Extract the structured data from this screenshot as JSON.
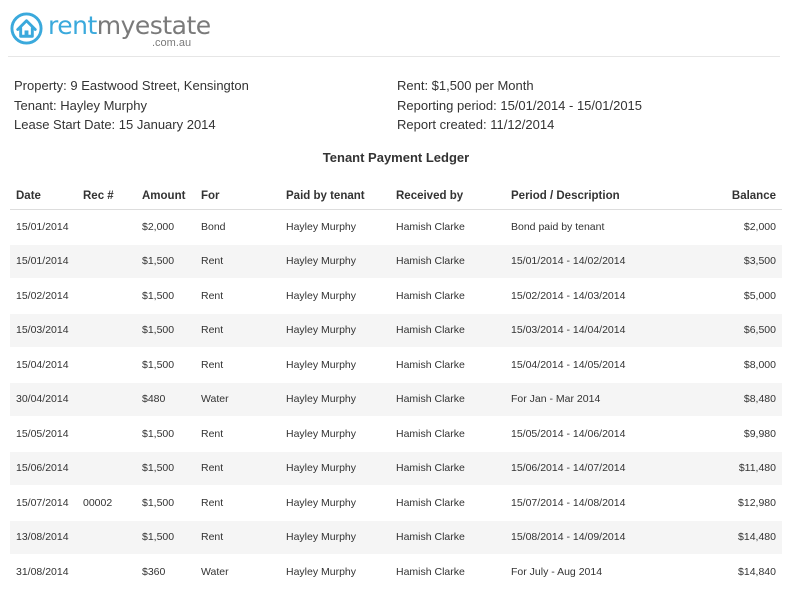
{
  "logo": {
    "part1": "rent",
    "part2": "myestate",
    "domain": ".com.au"
  },
  "info": {
    "property": "Property: 9 Eastwood Street, Kensington",
    "tenant": "Tenant: Hayley Murphy",
    "lease_start": "Lease Start Date: 15 January 2014",
    "rent": "Rent: $1,500 per Month",
    "reporting_period": "Reporting period: 15/01/2014 - 15/01/2015",
    "report_created": "Report created: 11/12/2014"
  },
  "title": "Tenant Payment Ledger",
  "columns": {
    "date": "Date",
    "rec": "Rec #",
    "amount": "Amount",
    "for": "For",
    "paid_by": "Paid by tenant",
    "received_by": "Received by",
    "period": "Period / Description",
    "balance": "Balance"
  },
  "rows": [
    {
      "date": "15/01/2014",
      "rec": "",
      "amount": "$2,000",
      "for": "Bond",
      "paid_by": "Hayley Murphy",
      "received_by": "Hamish Clarke",
      "period": "Bond paid by tenant",
      "balance": "$2,000"
    },
    {
      "date": "15/01/2014",
      "rec": "",
      "amount": "$1,500",
      "for": "Rent",
      "paid_by": "Hayley Murphy",
      "received_by": "Hamish Clarke",
      "period": "15/01/2014 - 14/02/2014",
      "balance": "$3,500"
    },
    {
      "date": "15/02/2014",
      "rec": "",
      "amount": "$1,500",
      "for": "Rent",
      "paid_by": "Hayley Murphy",
      "received_by": "Hamish Clarke",
      "period": "15/02/2014 - 14/03/2014",
      "balance": "$5,000"
    },
    {
      "date": "15/03/2014",
      "rec": "",
      "amount": "$1,500",
      "for": "Rent",
      "paid_by": "Hayley Murphy",
      "received_by": "Hamish Clarke",
      "period": "15/03/2014 - 14/04/2014",
      "balance": "$6,500"
    },
    {
      "date": "15/04/2014",
      "rec": "",
      "amount": "$1,500",
      "for": "Rent",
      "paid_by": "Hayley Murphy",
      "received_by": "Hamish Clarke",
      "period": "15/04/2014 - 14/05/2014",
      "balance": "$8,000"
    },
    {
      "date": "30/04/2014",
      "rec": "",
      "amount": "$480",
      "for": "Water",
      "paid_by": "Hayley Murphy",
      "received_by": "Hamish Clarke",
      "period": "For Jan - Mar 2014",
      "balance": "$8,480"
    },
    {
      "date": "15/05/2014",
      "rec": "",
      "amount": "$1,500",
      "for": "Rent",
      "paid_by": "Hayley Murphy",
      "received_by": "Hamish Clarke",
      "period": "15/05/2014 - 14/06/2014",
      "balance": "$9,980"
    },
    {
      "date": "15/06/2014",
      "rec": "",
      "amount": "$1,500",
      "for": "Rent",
      "paid_by": "Hayley Murphy",
      "received_by": "Hamish Clarke",
      "period": "15/06/2014 - 14/07/2014",
      "balance": "$11,480"
    },
    {
      "date": "15/07/2014",
      "rec": "00002",
      "amount": "$1,500",
      "for": "Rent",
      "paid_by": "Hayley Murphy",
      "received_by": "Hamish Clarke",
      "period": "15/07/2014 - 14/08/2014",
      "balance": "$12,980"
    },
    {
      "date": "13/08/2014",
      "rec": "",
      "amount": "$1,500",
      "for": "Rent",
      "paid_by": "Hayley Murphy",
      "received_by": "Hamish Clarke",
      "period": "15/08/2014 - 14/09/2014",
      "balance": "$14,480"
    },
    {
      "date": "31/08/2014",
      "rec": "",
      "amount": "$360",
      "for": "Water",
      "paid_by": "Hayley Murphy",
      "received_by": "Hamish Clarke",
      "period": "For July - Aug 2014",
      "balance": "$14,840"
    }
  ],
  "colors": {
    "brand_blue": "#3aa9dc",
    "brand_grey": "#7a7a7a",
    "row_stripe": "#f5f5f5"
  },
  "icons": {
    "logo": "house-icon"
  }
}
